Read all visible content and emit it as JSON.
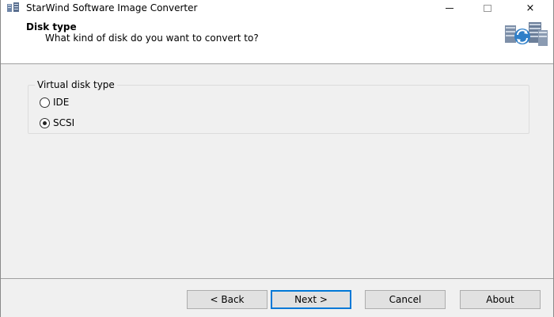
{
  "window": {
    "title": "StarWind Software Image Converter",
    "controls": {
      "minimize": "minimize-icon",
      "maximize": "maximize-icon",
      "close": "×"
    }
  },
  "header": {
    "title": "Disk type",
    "subtitle": "What kind of disk do you want to convert to?",
    "logo_icon": "servers-icon"
  },
  "group": {
    "label": "Virtual disk type",
    "options": [
      {
        "label": "IDE",
        "selected": false
      },
      {
        "label": "SCSI",
        "selected": true
      }
    ]
  },
  "buttons": {
    "back": "< Back",
    "next": "Next >",
    "cancel": "Cancel",
    "about": "About"
  },
  "colors": {
    "focus_border": "#0078d7",
    "panel_bg": "#f0f0f0"
  }
}
